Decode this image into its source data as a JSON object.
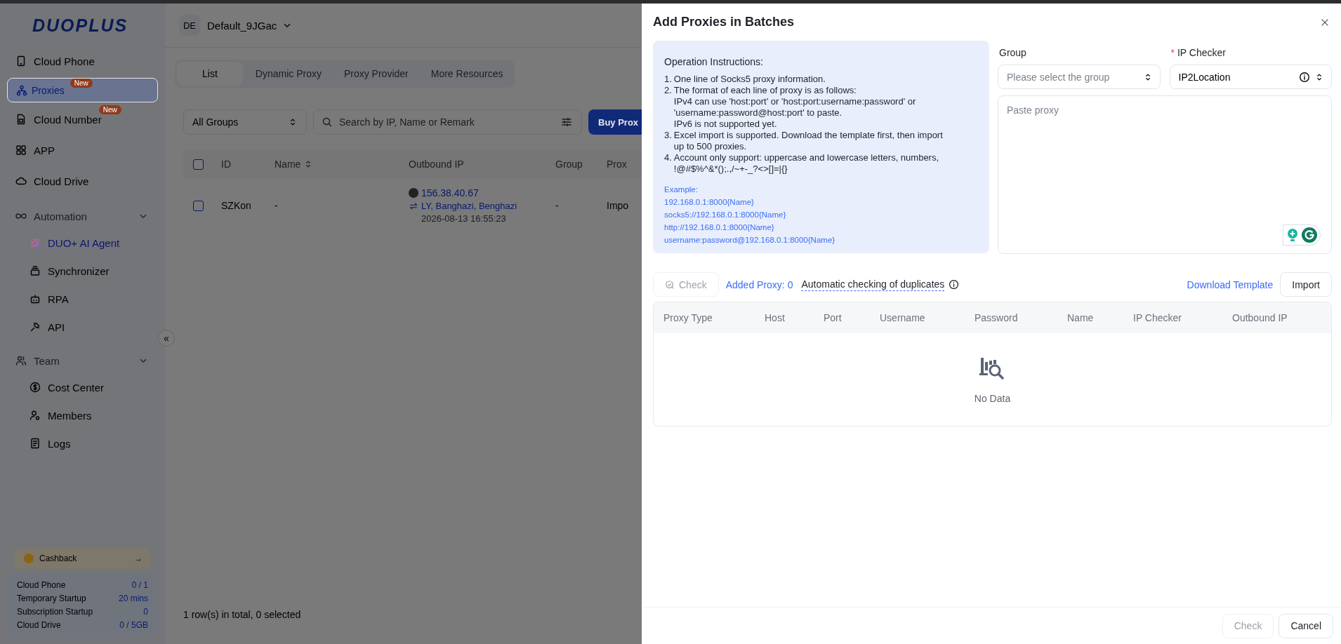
{
  "sidebar": {
    "logo": "DUOPLUS",
    "items": [
      {
        "label": "Cloud Phone",
        "selected": false
      },
      {
        "label": "Proxies",
        "selected": true,
        "badge": "New"
      },
      {
        "label": "Cloud Number",
        "selected": false,
        "badge": "New"
      },
      {
        "label": "APP",
        "selected": false
      },
      {
        "label": "Cloud Drive",
        "selected": false
      }
    ],
    "groups": [
      {
        "label": "Automation",
        "expanded": true,
        "children": [
          {
            "label": "DUO+ AI Agent",
            "kind": "featured"
          },
          {
            "label": "Synchronizer",
            "kind": "plain"
          },
          {
            "label": "RPA",
            "kind": "plain"
          },
          {
            "label": "API",
            "kind": "plain"
          }
        ]
      },
      {
        "label": "Team",
        "expanded": true,
        "children": [
          {
            "label": "Cost Center",
            "kind": "plain"
          },
          {
            "label": "Members",
            "kind": "plain"
          },
          {
            "label": "Logs",
            "kind": "plain"
          }
        ]
      }
    ],
    "collapse": "«",
    "cashback": {
      "label": "Cashback",
      "arrow": "→"
    },
    "stats": [
      {
        "label": "Cloud Phone",
        "value": "0 / 1"
      },
      {
        "label": "Temporary Startup",
        "value": "20 mins"
      },
      {
        "label": "Subscription Startup",
        "value": "0"
      },
      {
        "label": "Cloud Drive",
        "value": "0 / 5GB"
      }
    ]
  },
  "main": {
    "workspace": {
      "avatar": "DE",
      "name": "Default_9JGac"
    },
    "tabs": [
      {
        "label": "List",
        "selected": true
      },
      {
        "label": "Dynamic Proxy",
        "selected": false
      },
      {
        "label": "Proxy Provider",
        "selected": false
      },
      {
        "label": "More Resources",
        "selected": false
      }
    ],
    "toolbar": {
      "group_select": "All Groups",
      "search_placeholder": "Search by IP, Name or Remark",
      "buy_button": "Buy Prox"
    },
    "table": {
      "header_checked": false,
      "columns": [
        "ID",
        "Name",
        "Outbound IP",
        "Group",
        "Prox"
      ],
      "rows": [
        {
          "checked": false,
          "id": "SZKon",
          "name": "-",
          "ip": "156.38.40.67",
          "location": "LY, Banghazi, Benghazi",
          "time": "2026-08-13 16:55:23",
          "group": "-",
          "proxy": "Impo"
        }
      ]
    },
    "footer": "1 row(s) in total, 0 selected"
  },
  "drawer": {
    "title": "Add Proxies in Batches",
    "instructions": {
      "heading": "Operation Instructions:",
      "items": [
        {
          "number": "1.",
          "lines": [
            "One line of Socks5 proxy information."
          ]
        },
        {
          "number": "2.",
          "lines": [
            "The format of each line of proxy is as follows:",
            "IPv4 can use 'host:port' or 'host:port:username:password' or",
            "'username:password@host:port' to paste.",
            "IPv6 is not supported yet."
          ]
        },
        {
          "number": "3.",
          "lines": [
            "Excel import is supported. Download the template first, then import",
            "up to 500 proxies."
          ]
        },
        {
          "number": "4.",
          "lines": [
            "Account only support: uppercase and lowercase letters, numbers,",
            "!@#$%^&*();.,/~+-_?<>[]=|{}"
          ]
        }
      ],
      "example_label": "Example:",
      "examples": [
        "192.168.0.1:8000{Name}",
        "socks5://192.168.0.1:8000{Name}",
        "http://192.168.0.1:8000{Name}",
        "username:password@192.168.0.1:8000{Name}"
      ]
    },
    "group": {
      "label": "Group",
      "placeholder": "Please select the group"
    },
    "ip_checker": {
      "required_mark": "*",
      "label": "IP Checker",
      "value": "IP2Location"
    },
    "paste": {
      "placeholder": "Paste proxy"
    },
    "actions": {
      "check": {
        "label": "Check",
        "disabled": true
      },
      "added": "Added Proxy: 0",
      "duplicates": "Automatic checking of duplicates",
      "download": "Download Template",
      "import": "Import"
    },
    "result_table": {
      "columns": [
        "Proxy Type",
        "Host",
        "Port",
        "Username",
        "Password",
        "Name",
        "IP Checker",
        "Outbound IP"
      ],
      "empty": "No Data"
    },
    "footer": {
      "check": {
        "label": "Check",
        "disabled": true
      },
      "cancel": "Cancel"
    }
  }
}
